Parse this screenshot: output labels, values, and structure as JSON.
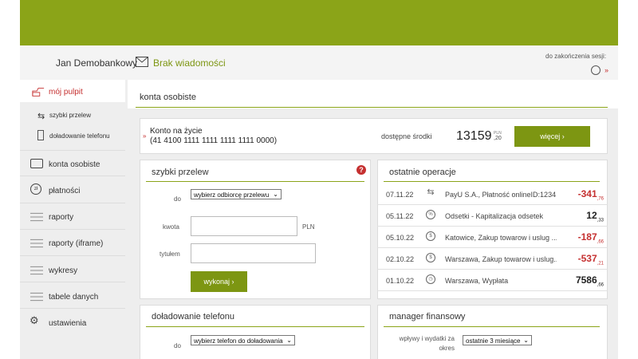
{
  "header": {
    "user_name": "Jan Demobankowy",
    "messages_label": "Brak wiadomości",
    "session_label": "do zakończenia sesji:"
  },
  "sidebar": {
    "items": [
      {
        "label": "mój pulpit",
        "icon": "desk-icon",
        "active": true
      },
      {
        "label": "szybki przelew",
        "icon": "transfer-icon"
      },
      {
        "label": "doładowanie telefonu",
        "icon": "phone-icon"
      },
      {
        "label": "konta osobiste",
        "icon": "wallet-icon"
      },
      {
        "label": "płatności",
        "icon": "payments-icon"
      },
      {
        "label": "raporty",
        "icon": "list-icon"
      },
      {
        "label": "raporty (iframe)",
        "icon": "list-icon"
      },
      {
        "label": "wykresy",
        "icon": "list-icon"
      },
      {
        "label": "tabele danych",
        "icon": "list-icon"
      },
      {
        "label": "ustawienia",
        "icon": "gears-icon"
      }
    ]
  },
  "accounts": {
    "title": "konta osobiste",
    "account_name": "Konto na życie",
    "account_number": "(41 4100 1111 1111 1111 1111 0000)",
    "available_label": "dostępne środki",
    "balance_main": "13159",
    "balance_currency": "PLN",
    "balance_fraction": ",20",
    "more_button": "więcej ›"
  },
  "quick_transfer": {
    "title": "szybki przelew",
    "to_label": "do",
    "to_select": "wybierz odbiorcę przelewu",
    "amount_label": "kwota",
    "currency": "PLN",
    "title_label": "tytułem",
    "submit": "wykonaj ›"
  },
  "operations": {
    "title": "ostatnie operacje",
    "rows": [
      {
        "date": "07.11.22",
        "icon": "transfer-icon",
        "desc": "PayU S.A., Płatność onlineID:1234...",
        "amount": "-341",
        "fraction": ",76",
        "currency": "PLN",
        "negative": true
      },
      {
        "date": "05.11.22",
        "icon": "percent-icon",
        "desc": "Odsetki - Kapitalizacja odsetek",
        "amount": "12",
        "fraction": ",33",
        "currency": "PLN",
        "negative": false
      },
      {
        "date": "05.10.22",
        "icon": "bag-icon",
        "desc": "Katowice, Zakup towarow i uslug ...",
        "amount": "-187",
        "fraction": ",66",
        "currency": "PLN",
        "negative": true
      },
      {
        "date": "02.10.22",
        "icon": "bag-icon",
        "desc": "Warszawa, Zakup towarow i uslug...",
        "amount": "-537",
        "fraction": ",21",
        "currency": "PLN",
        "negative": true
      },
      {
        "date": "01.10.22",
        "icon": "clock-icon",
        "desc": "Warszawa, Wypłata",
        "amount": "7586",
        "fraction": ",66",
        "currency": "PLN",
        "negative": false
      }
    ]
  },
  "phone_topup": {
    "title": "doładowanie telefonu",
    "to_label": "do",
    "select": "wybierz telefon do doładowania"
  },
  "finance_manager": {
    "title": "manager finansowy",
    "label_line1": "wpływy i wydatki za",
    "label_line2": "okres",
    "select": "ostatnie 3 miesiące"
  },
  "colors": {
    "brand": "#8ba418",
    "negative": "#c53030"
  }
}
